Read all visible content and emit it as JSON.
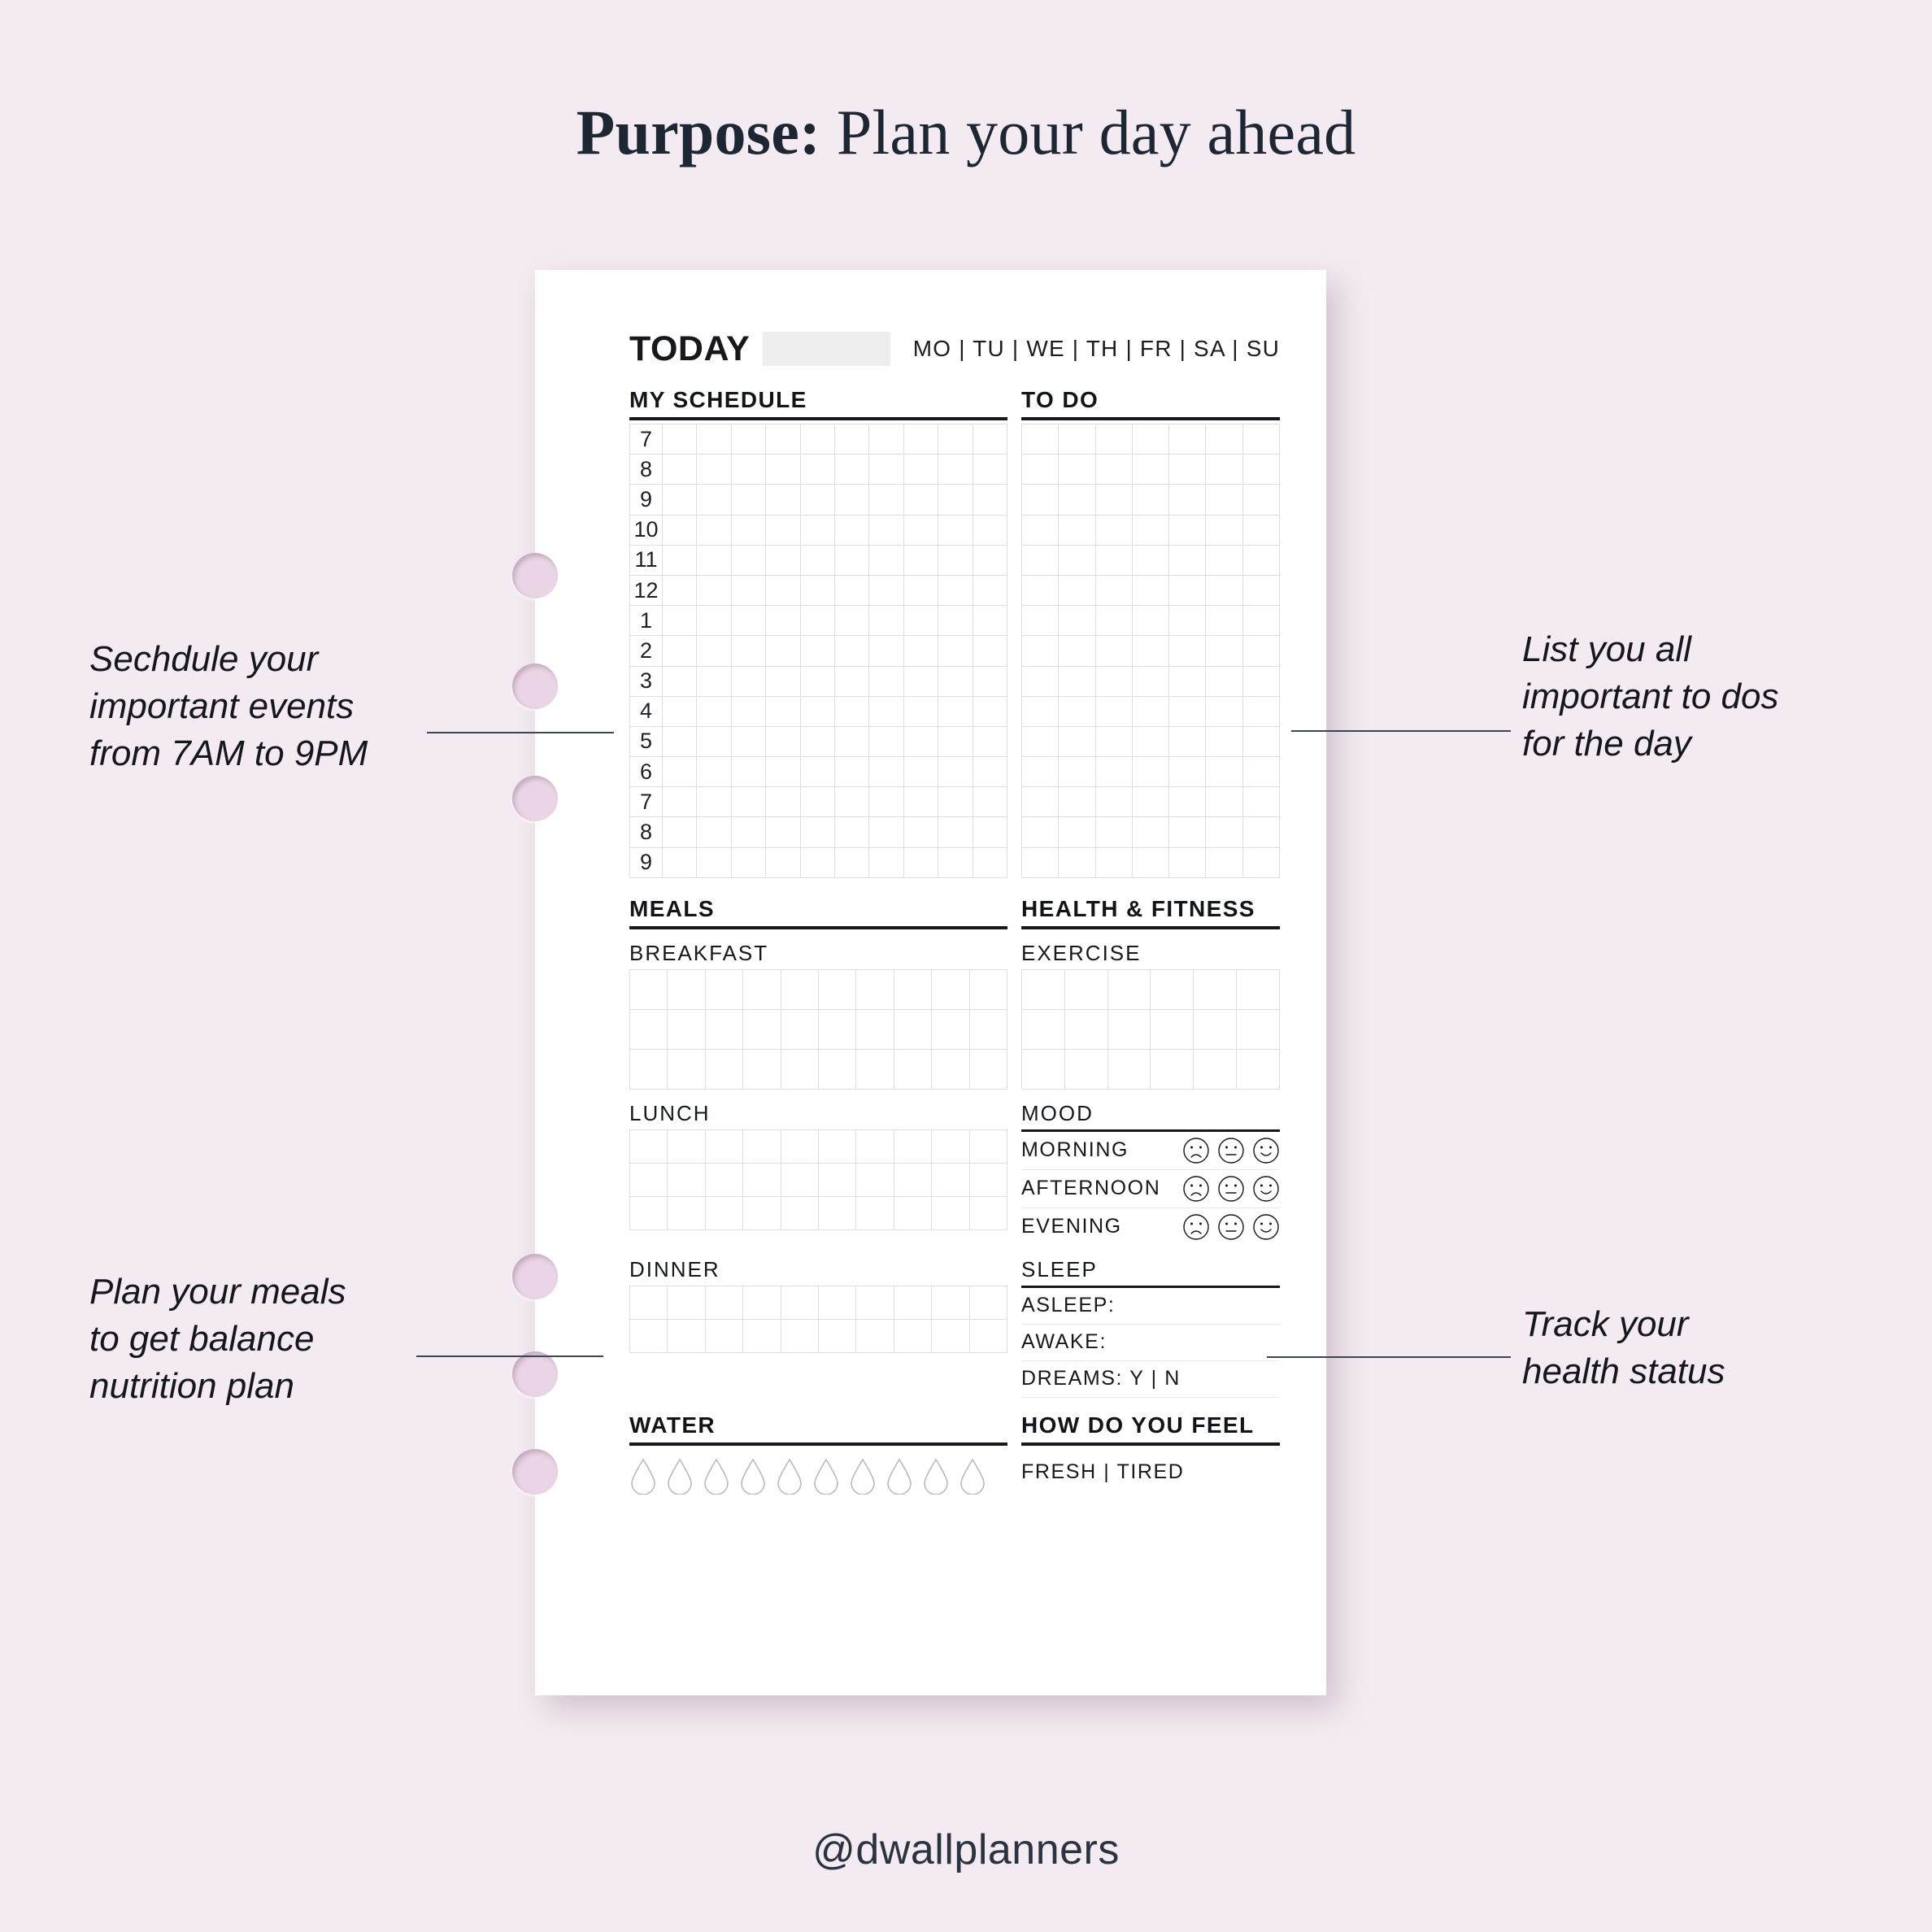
{
  "header": {
    "title_bold": "Purpose:",
    "title_rest": " Plan your day ahead"
  },
  "footer": {
    "handle": "@dwallplanners"
  },
  "planner": {
    "today_label": "TODAY",
    "today_value": "",
    "weekdays": "MO | TU | WE | TH | FR | SA | SU",
    "sections": {
      "my_schedule": "MY SCHEDULE",
      "to_do": "TO DO",
      "meals": "MEALS",
      "health_fitness": "HEALTH & FITNESS",
      "water": "WATER",
      "how_do_you_feel": "HOW DO YOU FEEL"
    },
    "schedule_hours": [
      "7",
      "8",
      "9",
      "10",
      "11",
      "12",
      "1",
      "2",
      "3",
      "4",
      "5",
      "6",
      "7",
      "8",
      "9"
    ],
    "meals": {
      "breakfast": "BREAKFAST",
      "lunch": "LUNCH",
      "dinner": "DINNER"
    },
    "health": {
      "exercise": "EXERCISE",
      "mood_title": "MOOD",
      "mood_rows": [
        "MORNING",
        "AFTERNOON",
        "EVENING"
      ],
      "mood_faces": [
        "sad-face-icon",
        "neutral-face-icon",
        "happy-face-icon"
      ],
      "sleep_title": "SLEEP",
      "sleep_rows": [
        "ASLEEP:",
        "AWAKE:",
        "DREAMS:  Y | N"
      ]
    },
    "water_drop_count": 10,
    "feel_options": "FRESH | TIRED"
  },
  "annotations": {
    "schedule": "Sechdule your\nimportant events\nfrom 7AM to 9PM",
    "todo": "List you all\nimportant to dos\nfor the day",
    "meals": "Plan your meals\nto get balance\nnutrition plan",
    "health": "Track your\nhealth status"
  },
  "colors": {
    "background": "#f4eaf1",
    "card": "#ffffff",
    "ink": "#15181c",
    "hole": "#ead5e6",
    "grid_line": "#dededd",
    "today_blank": "#efeeee"
  }
}
